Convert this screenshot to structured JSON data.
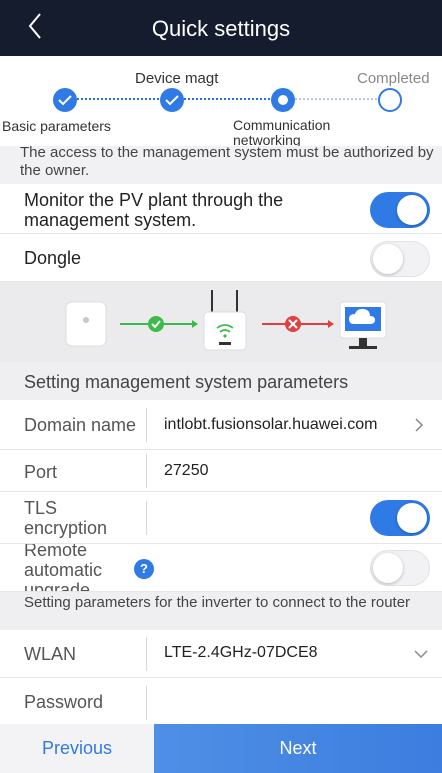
{
  "header": {
    "title": "Quick settings",
    "back_icon": "chevron-left-icon"
  },
  "stepper": {
    "steps": [
      {
        "label": "Basic parameters",
        "state": "done"
      },
      {
        "label": "Device magt",
        "state": "done"
      },
      {
        "label": "Communication networking",
        "state": "current"
      },
      {
        "label": "Completed",
        "state": "todo"
      }
    ],
    "accent": "#2f7ae5"
  },
  "notice": "The access to the management system must be authorized by the owner.",
  "monitor": {
    "label": "Monitor the PV plant through the management system.",
    "enabled": true
  },
  "dongle": {
    "label": "Dongle",
    "enabled": false
  },
  "diagram": {
    "items": [
      "inverter-icon",
      "router-icon",
      "cloud-server-icon"
    ],
    "link1_status": "ok",
    "link2_status": "error",
    "ok_color": "#3dbb4a",
    "error_color": "#e04040"
  },
  "mgmt_section": {
    "title": "Setting management system parameters"
  },
  "domain": {
    "label": "Domain name",
    "value": "intlobt.fusionsolar.huawei.com"
  },
  "port": {
    "label": "Port",
    "value": "27250"
  },
  "tls": {
    "label": "TLS encryption",
    "enabled": true
  },
  "upgrade": {
    "label": "Remote automatic upgrade",
    "enabled": false,
    "help_icon": "help-icon"
  },
  "router_section": {
    "title": "Setting parameters for the inverter to connect to the router"
  },
  "wlan": {
    "label": "WLAN",
    "value": "LTE-2.4GHz-07DCE8"
  },
  "password": {
    "label": "Password",
    "value": ""
  },
  "footer": {
    "previous_label": "Previous",
    "next_label": "Next"
  }
}
